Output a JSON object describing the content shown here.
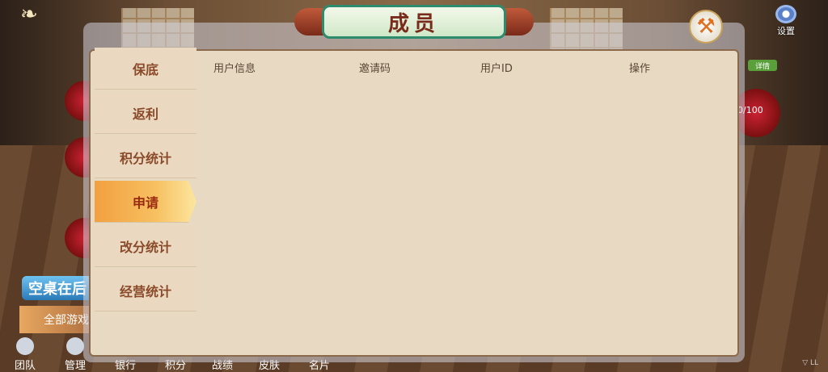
{
  "header": {
    "title": "成员",
    "settings_label": "设置",
    "close_icon": "hammer-icon"
  },
  "sidebar": {
    "items": [
      {
        "label": "保底",
        "active": false
      },
      {
        "label": "返利",
        "active": false
      },
      {
        "label": "积分统计",
        "active": false
      },
      {
        "label": "申请",
        "active": true
      },
      {
        "label": "改分统计",
        "active": false
      },
      {
        "label": "经营统计",
        "active": false
      }
    ]
  },
  "table": {
    "columns": [
      "用户信息",
      "邀请码",
      "用户ID",
      "操作"
    ]
  },
  "background": {
    "detail_badge": "详情",
    "count": "0/100",
    "empty_table_button": "空桌在后",
    "all_games_button": "全部游戏"
  },
  "bottom_nav": {
    "items": [
      "团队",
      "管理",
      "银行",
      "积分",
      "战绩",
      "皮肤",
      "名片"
    ]
  },
  "colors": {
    "panel_bg": "#e8d9c2",
    "active_tab": "#f2a040",
    "title_text": "#7a2a1a",
    "accent_green": "#2e8c6e"
  }
}
